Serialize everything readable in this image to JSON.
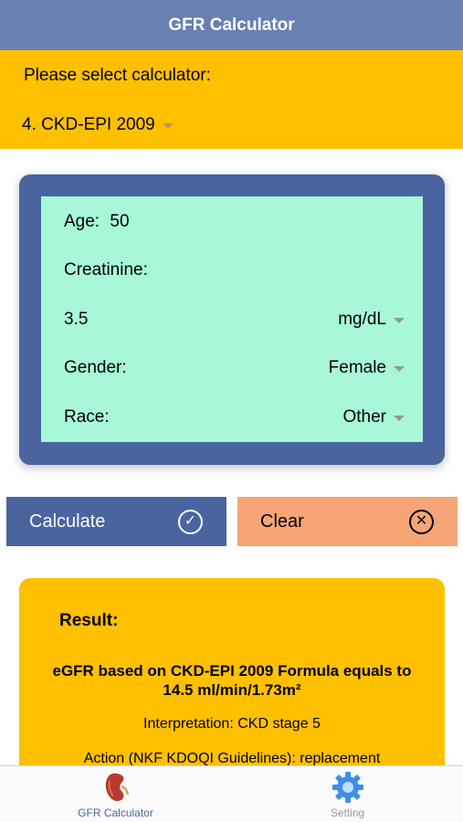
{
  "header": {
    "title": "GFR Calculator"
  },
  "selector": {
    "prompt": "Please select calculator:",
    "value": "4. CKD-EPI 2009"
  },
  "form": {
    "age_label": "Age:",
    "age_value": "50",
    "creatinine_label": "Creatinine:",
    "creatinine_value": "3.5",
    "unit": "mg/dL",
    "gender_label": "Gender:",
    "gender_value": "Female",
    "race_label": "Race:",
    "race_value": "Other"
  },
  "buttons": {
    "calculate": "Calculate",
    "clear": "Clear"
  },
  "result": {
    "heading": "Result:",
    "formula_line1": "eGFR based on CKD-EPI 2009 Formula equals to",
    "formula_line2": "14.5 ml/min/1.73m²",
    "interpretation": "Interpretation: CKD stage 5",
    "action": "Action (NKF KDOQI Guidelines): replacement"
  },
  "tabs": [
    {
      "label": "GFR Calculator",
      "icon": "kidney-icon",
      "active": true
    },
    {
      "label": "Setting",
      "icon": "gear-icon",
      "active": false
    }
  ],
  "colors": {
    "header": "#6a80b3",
    "accent_yellow": "#ffc000",
    "card_blue": "#4a64a0",
    "mint": "#a8f7d8",
    "clear_orange": "#f6a576"
  }
}
